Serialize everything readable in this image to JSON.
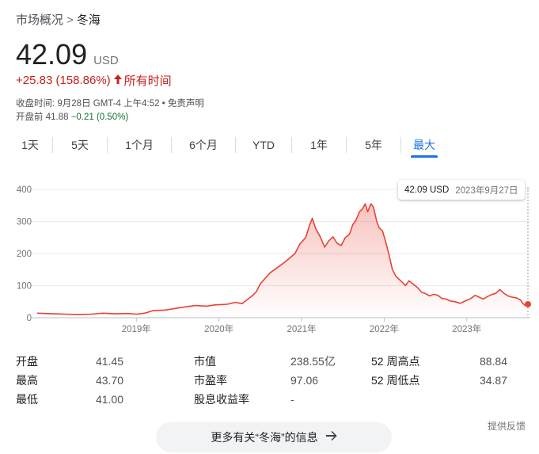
{
  "breadcrumb": {
    "parent": "市场概况",
    "separator": ">",
    "current": "冬海"
  },
  "quote": {
    "price": "42.09",
    "currency": "USD",
    "change": "+25.83 (158.86%)",
    "period": "所有时间",
    "close_info": "收盘时间: 9月28日 GMT-4 上午4:52 • ",
    "disclaimer": "免责声明",
    "premarket_label": "开盘前",
    "premarket_price": "41.88",
    "premarket_change": "−0.21 (0.50%)"
  },
  "tabs": [
    {
      "label": "1天"
    },
    {
      "label": "5天"
    },
    {
      "label": "1个月"
    },
    {
      "label": "6个月"
    },
    {
      "label": "YTD"
    },
    {
      "label": "1年"
    },
    {
      "label": "5年"
    },
    {
      "label": "最大",
      "active": true
    }
  ],
  "tooltip": {
    "price": "42.09 USD",
    "date": "2023年9月27日"
  },
  "chart_data": {
    "type": "area",
    "y_ticks": [
      "400",
      "300",
      "200",
      "100",
      "0"
    ],
    "ylim": [
      0,
      400
    ],
    "x_ticks": [
      {
        "label": "2019年",
        "t": 2019.0
      },
      {
        "label": "2020年",
        "t": 2020.0
      },
      {
        "label": "2021年",
        "t": 2021.0
      },
      {
        "label": "2022年",
        "t": 2022.0
      },
      {
        "label": "2023年",
        "t": 2023.0
      }
    ],
    "line_color": "#e94235",
    "grid": true,
    "series": [
      {
        "points": [
          [
            2017.8,
            14
          ],
          [
            2017.9,
            13
          ],
          [
            2018.0,
            12
          ],
          [
            2018.15,
            11
          ],
          [
            2018.3,
            10
          ],
          [
            2018.45,
            11
          ],
          [
            2018.6,
            14
          ],
          [
            2018.75,
            12
          ],
          [
            2018.9,
            13
          ],
          [
            2019.0,
            11
          ],
          [
            2019.1,
            14
          ],
          [
            2019.2,
            22
          ],
          [
            2019.35,
            24
          ],
          [
            2019.5,
            30
          ],
          [
            2019.6,
            34
          ],
          [
            2019.72,
            38
          ],
          [
            2019.85,
            36
          ],
          [
            2019.95,
            40
          ],
          [
            2020.1,
            42
          ],
          [
            2020.2,
            48
          ],
          [
            2020.28,
            44
          ],
          [
            2020.35,
            58
          ],
          [
            2020.4,
            68
          ],
          [
            2020.45,
            80
          ],
          [
            2020.5,
            105
          ],
          [
            2020.55,
            120
          ],
          [
            2020.62,
            140
          ],
          [
            2020.7,
            155
          ],
          [
            2020.78,
            170
          ],
          [
            2020.85,
            185
          ],
          [
            2020.92,
            200
          ],
          [
            2020.98,
            230
          ],
          [
            2021.05,
            250
          ],
          [
            2021.1,
            290
          ],
          [
            2021.13,
            310
          ],
          [
            2021.17,
            278
          ],
          [
            2021.22,
            255
          ],
          [
            2021.28,
            220
          ],
          [
            2021.33,
            240
          ],
          [
            2021.38,
            252
          ],
          [
            2021.43,
            232
          ],
          [
            2021.48,
            225
          ],
          [
            2021.53,
            250
          ],
          [
            2021.58,
            260
          ],
          [
            2021.62,
            290
          ],
          [
            2021.66,
            305
          ],
          [
            2021.7,
            330
          ],
          [
            2021.74,
            340
          ],
          [
            2021.77,
            355
          ],
          [
            2021.8,
            330
          ],
          [
            2021.84,
            355
          ],
          [
            2021.87,
            345
          ],
          [
            2021.91,
            300
          ],
          [
            2021.94,
            280
          ],
          [
            2021.98,
            270
          ],
          [
            2022.02,
            235
          ],
          [
            2022.06,
            195
          ],
          [
            2022.1,
            150
          ],
          [
            2022.14,
            130
          ],
          [
            2022.18,
            120
          ],
          [
            2022.22,
            110
          ],
          [
            2022.26,
            100
          ],
          [
            2022.3,
            115
          ],
          [
            2022.35,
            105
          ],
          [
            2022.4,
            95
          ],
          [
            2022.45,
            80
          ],
          [
            2022.5,
            75
          ],
          [
            2022.55,
            68
          ],
          [
            2022.6,
            73
          ],
          [
            2022.65,
            70
          ],
          [
            2022.7,
            60
          ],
          [
            2022.75,
            58
          ],
          [
            2022.8,
            52
          ],
          [
            2022.86,
            50
          ],
          [
            2022.92,
            45
          ],
          [
            2022.98,
            52
          ],
          [
            2023.05,
            60
          ],
          [
            2023.1,
            70
          ],
          [
            2023.15,
            64
          ],
          [
            2023.2,
            58
          ],
          [
            2023.25,
            66
          ],
          [
            2023.3,
            72
          ],
          [
            2023.35,
            76
          ],
          [
            2023.4,
            88
          ],
          [
            2023.45,
            76
          ],
          [
            2023.5,
            68
          ],
          [
            2023.55,
            64
          ],
          [
            2023.6,
            62
          ],
          [
            2023.65,
            55
          ],
          [
            2023.68,
            44
          ],
          [
            2023.71,
            38
          ],
          [
            2023.74,
            42.09
          ]
        ]
      }
    ]
  },
  "stats": {
    "col1": [
      {
        "label": "开盘",
        "value": "41.45"
      },
      {
        "label": "最高",
        "value": "43.70"
      },
      {
        "label": "最低",
        "value": "41.00"
      }
    ],
    "col2": [
      {
        "label": "市值",
        "value": "238.55亿"
      },
      {
        "label": "市盈率",
        "value": "97.06"
      },
      {
        "label": "股息收益率",
        "value": "-"
      }
    ],
    "col3": [
      {
        "label": "52 周高点",
        "value": "88.84"
      },
      {
        "label": "52 周低点",
        "value": "34.87"
      }
    ]
  },
  "feedback": "提供反馈",
  "more_button": "更多有关“冬海”的信息"
}
